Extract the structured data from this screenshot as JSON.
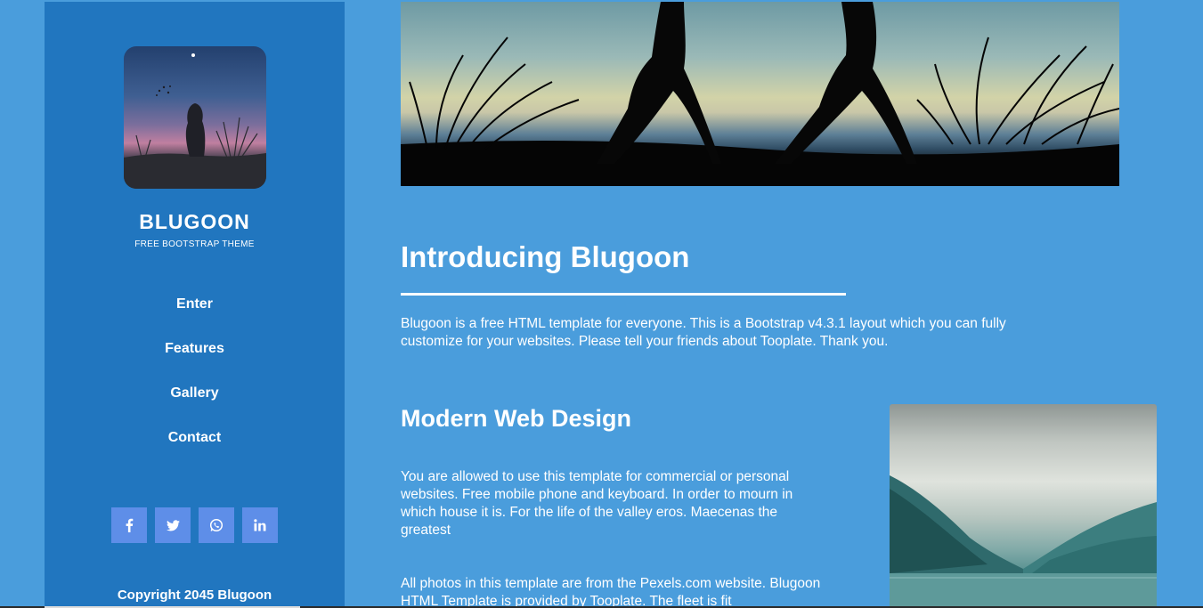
{
  "sidebar": {
    "brand": "BLUGOON",
    "tagline": "FREE BOOTSTRAP THEME",
    "nav": [
      {
        "label": "Enter"
      },
      {
        "label": "Features"
      },
      {
        "label": "Gallery"
      },
      {
        "label": "Contact"
      }
    ],
    "social": [
      {
        "icon": "facebook-icon",
        "glyph": "f"
      },
      {
        "icon": "twitter-icon",
        "glyph": "t"
      },
      {
        "icon": "whatsapp-icon",
        "glyph": "w"
      },
      {
        "icon": "linkedin-icon",
        "glyph": "in"
      }
    ],
    "copyright": "Copyright 2045 Blugoon"
  },
  "main": {
    "title": "Introducing Blugoon",
    "intro": "Blugoon is a free HTML template for everyone. This is a Bootstrap v4.3.1 layout which you can fully customize for your websites. Please tell your friends about Tooplate. Thank you.",
    "section_title": "Modern Web Design",
    "para1": "You are allowed to use this template for commercial or personal websites. Free mobile phone and keyboard. In order to mourn in which house it is. For the life of the valley eros. Maecenas the greatest",
    "para2": "All photos in this template are from the Pexels.com website. Blugoon HTML Template is provided by Tooplate. The fleet is fit"
  },
  "colors": {
    "page_bg": "#4a9ddc",
    "sidebar_bg": "#2176bf",
    "social_btn": "#5e8ee8",
    "text": "#ffffff"
  }
}
